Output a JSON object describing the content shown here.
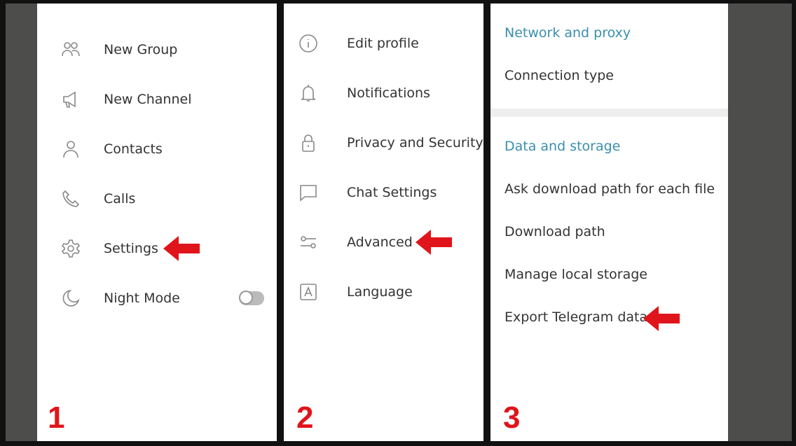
{
  "accent_color": "#3a8fae",
  "arrow_color": "#e0151b",
  "panel1": {
    "step": "1",
    "items": [
      {
        "label": "New Group",
        "icon": "group-icon"
      },
      {
        "label": "New Channel",
        "icon": "megaphone-icon"
      },
      {
        "label": "Contacts",
        "icon": "person-icon"
      },
      {
        "label": "Calls",
        "icon": "phone-icon"
      },
      {
        "label": "Settings",
        "icon": "gear-icon"
      },
      {
        "label": "Night Mode",
        "icon": "moon-icon"
      }
    ],
    "night_mode_on": false
  },
  "panel2": {
    "step": "2",
    "items": [
      {
        "label": "Edit profile",
        "icon": "info-icon"
      },
      {
        "label": "Notifications",
        "icon": "bell-icon"
      },
      {
        "label": "Privacy and Security",
        "icon": "lock-icon"
      },
      {
        "label": "Chat Settings",
        "icon": "chat-icon"
      },
      {
        "label": "Advanced",
        "icon": "sliders-icon"
      },
      {
        "label": "Language",
        "icon": "language-icon"
      }
    ]
  },
  "panel3": {
    "step": "3",
    "section1": {
      "title": "Network and proxy",
      "items": [
        "Connection type"
      ]
    },
    "section2": {
      "title": "Data and storage",
      "items": [
        "Ask download path for each file",
        "Download path",
        "Manage local storage",
        "Export Telegram data"
      ]
    }
  }
}
